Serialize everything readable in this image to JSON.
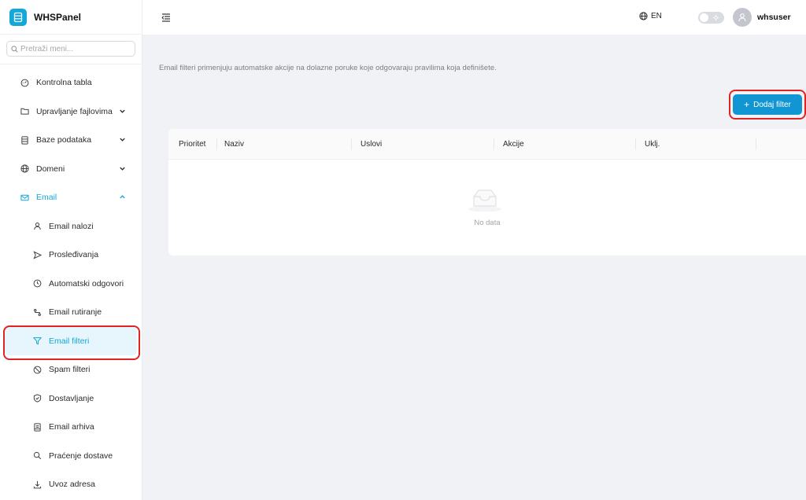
{
  "brand": {
    "name": "WHSPanel",
    "accent": "#13a8d8"
  },
  "search": {
    "placeholder": "Pretraži meni..."
  },
  "menu": [
    {
      "label": "Kontrolna tabla",
      "icon": "dashboard-icon"
    },
    {
      "label": "Upravljanje fajlovima",
      "icon": "folder-icon",
      "chevron": "down"
    },
    {
      "label": "Baze podataka",
      "icon": "database-icon",
      "chevron": "down"
    },
    {
      "label": "Domeni",
      "icon": "globe-icon",
      "chevron": "down"
    },
    {
      "label": "Email",
      "icon": "mail-icon",
      "chevron": "up",
      "open": true
    },
    {
      "label": "Email nalozi",
      "icon": "user-icon",
      "sub": true
    },
    {
      "label": "Prosleđivanja",
      "icon": "send-icon",
      "sub": true
    },
    {
      "label": "Automatski odgovori",
      "icon": "clock-icon",
      "sub": true
    },
    {
      "label": "Email rutiranje",
      "icon": "route-icon",
      "sub": true
    },
    {
      "label": "Email filteri",
      "icon": "filter-icon",
      "sub": true,
      "active": true
    },
    {
      "label": "Spam filteri",
      "icon": "block-icon",
      "sub": true
    },
    {
      "label": "Dostavljanje",
      "icon": "shield-check-icon",
      "sub": true
    },
    {
      "label": "Email arhiva",
      "icon": "archive-icon",
      "sub": true
    },
    {
      "label": "Praćenje dostave",
      "icon": "search-icon",
      "sub": true
    },
    {
      "label": "Uvoz adresa",
      "icon": "import-icon",
      "sub": true
    }
  ],
  "header": {
    "language": "EN",
    "username": "whsuser"
  },
  "main": {
    "description": "Email filteri primenjuju automatske akcije na dolazne poruke koje odgovaraju pravilima koja definišete.",
    "add_button": "Dodaj filter",
    "columns": [
      "Prioritet",
      "Naziv",
      "Uslovi",
      "Akcije",
      "Uklj."
    ],
    "empty_text": "No data"
  },
  "colors": {
    "primary_button": "#1296d3",
    "highlight": "#e02424"
  }
}
